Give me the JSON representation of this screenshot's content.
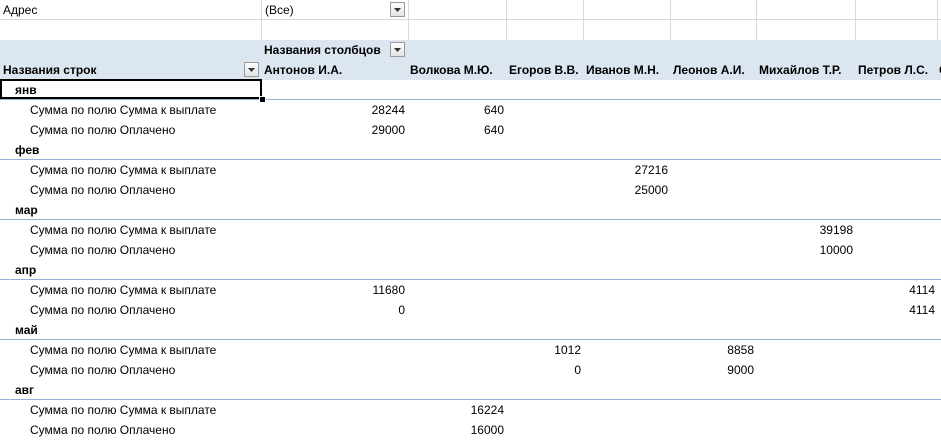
{
  "filter": {
    "label": "Адрес",
    "value": "(Все)"
  },
  "pivot": {
    "col_header_label": "Названия столбцов",
    "row_header_label": "Названия строк",
    "columns": [
      "Антонов И.А.",
      "Волкова М.Ю.",
      "Егоров В.В.",
      "Иванов М.Н.",
      "Леонов А.И.",
      "Михайлов Т.Р.",
      "Петров Л.С.",
      "С"
    ],
    "row_labels": {
      "due": "Сумма по полю Сумма к выплате",
      "paid": "Сумма по полю Оплачено"
    },
    "groups": [
      {
        "name": "янв",
        "due": [
          "28244",
          "640",
          "",
          "",
          "",
          "",
          "",
          ""
        ],
        "paid": [
          "29000",
          "640",
          "",
          "",
          "",
          "",
          "",
          ""
        ]
      },
      {
        "name": "фев",
        "due": [
          "",
          "",
          "",
          "27216",
          "",
          "",
          "",
          ""
        ],
        "paid": [
          "",
          "",
          "",
          "25000",
          "",
          "",
          "",
          ""
        ]
      },
      {
        "name": "мар",
        "due": [
          "",
          "",
          "",
          "",
          "",
          "39198",
          "",
          ""
        ],
        "paid": [
          "",
          "",
          "",
          "",
          "",
          "10000",
          "",
          ""
        ]
      },
      {
        "name": "апр",
        "due": [
          "11680",
          "",
          "",
          "",
          "",
          "",
          "4114",
          ""
        ],
        "paid": [
          "0",
          "",
          "",
          "",
          "",
          "",
          "4114",
          ""
        ]
      },
      {
        "name": "май",
        "due": [
          "",
          "",
          "1012",
          "",
          "8858",
          "",
          "",
          ""
        ],
        "paid": [
          "",
          "",
          "0",
          "",
          "9000",
          "",
          "",
          ""
        ]
      },
      {
        "name": "авг",
        "due": [
          "",
          "16224",
          "",
          "",
          "",
          "",
          "",
          ""
        ],
        "paid": [
          "",
          "16000",
          "",
          "",
          "",
          "",
          "",
          ""
        ]
      }
    ]
  },
  "colors": {
    "header_band": "#dce6f1",
    "separator": "#95b3d7",
    "grid": "#d9d9d9"
  }
}
